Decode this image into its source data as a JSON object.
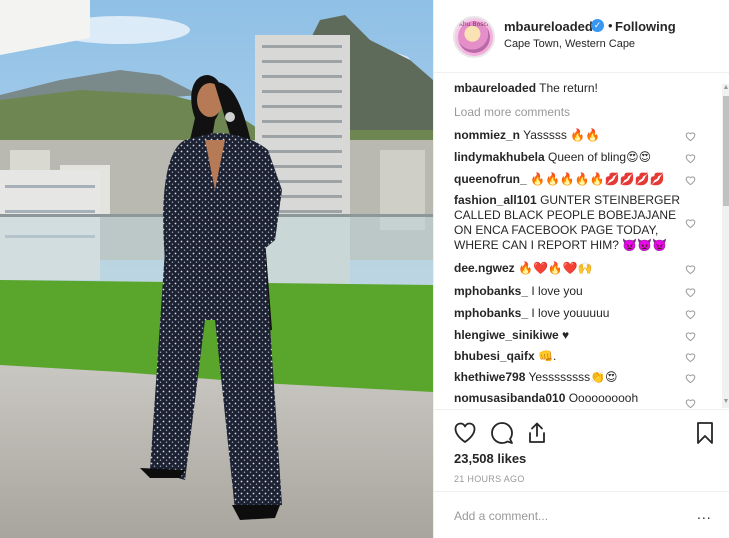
{
  "post": {
    "username": "mbaureloaded",
    "follow_label": "Following",
    "dot": "•",
    "location": "Cape Town, Western Cape",
    "avatar_text": "Khu Bosch"
  },
  "caption": {
    "username": "mbaureloaded",
    "text": "The return!"
  },
  "load_more": "Load more comments",
  "comments": [
    {
      "user": "nommiez_n",
      "text": "Yasssss 🔥🔥"
    },
    {
      "user": "lindymakhubela",
      "text": "Queen of bling😍😍"
    },
    {
      "user": "queenofrun_",
      "text": "🔥🔥🔥🔥🔥💋💋💋💋"
    },
    {
      "user": "fashion_all101",
      "text": "GUNTER STEINBERGER CALLED BLACK PEOPLE BOBEJAJANE ON ENCA FACEBOOK PAGE TODAY, WHERE CAN I REPORT HIM? 👿👿👿"
    },
    {
      "user": "dee.ngwez",
      "text": "🔥❤️🔥❤️🙌"
    },
    {
      "user": "mphobanks_",
      "text": "I love you"
    },
    {
      "user": "mphobanks_",
      "text": "I love youuuuu"
    },
    {
      "user": "hlengiwe_sinikiwe",
      "text": "♥"
    },
    {
      "user": "bhubesi_qaifx",
      "text": "👊."
    },
    {
      "user": "khethiwe798",
      "text": "Yessssssss👏😍"
    },
    {
      "user": "nomusasibanda010",
      "text": "Oooooooooh"
    }
  ],
  "likes": "23,508 likes",
  "time_ago": "21 HOURS AGO",
  "add_comment_placeholder": "Add a comment...",
  "more_label": "...",
  "icons": {
    "verified": "verified-badge-icon",
    "like": "heart-outline-icon",
    "comment": "speech-bubble-icon",
    "share": "share-upload-icon",
    "save": "bookmark-icon",
    "comment_like": "small-heart-icon"
  },
  "colors": {
    "accent": "#3897f0",
    "muted": "#999999",
    "text": "#262626",
    "border": "#efefef"
  }
}
